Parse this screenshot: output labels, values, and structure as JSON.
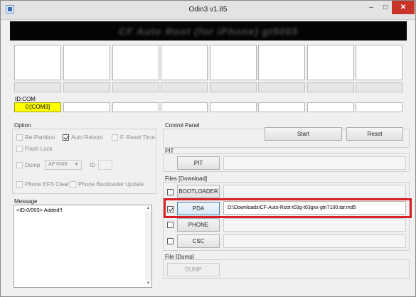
{
  "window": {
    "title": "Odin3 v1.85",
    "controls": {
      "minimize": "–",
      "maximize": "□",
      "close": "✕"
    }
  },
  "banner": {
    "text": "CF Auto Root (for iPhone) gt5005"
  },
  "id_com": {
    "label": "ID:COM",
    "ports": [
      "0:[COM3]",
      "",
      "",
      "",
      "",
      "",
      "",
      ""
    ]
  },
  "option": {
    "title": "Option",
    "re_partition": {
      "label": "Re-Partition",
      "checked": false,
      "enabled": false
    },
    "auto_reboot": {
      "label": "Auto Reboot",
      "checked": true,
      "enabled": false
    },
    "f_reset_time": {
      "label": "F. Reset Time",
      "checked": false,
      "enabled": false
    },
    "flash_lock": {
      "label": "Flash Lock",
      "checked": false,
      "enabled": false
    },
    "dump": {
      "label": "Dump",
      "checked": false,
      "enabled": false
    },
    "dump_target": "AP RAM",
    "id_label": "ID",
    "id_value": "",
    "phone_efs_clear": {
      "label": "Phone EFS Clear",
      "checked": false,
      "enabled": false
    },
    "phone_bootloader_update": {
      "label": "Phone Bootloader Update",
      "checked": false,
      "enabled": false
    }
  },
  "message": {
    "title": "Message",
    "log": "<ID:0/003> Added!!"
  },
  "control_panel": {
    "title": "Control Panel",
    "start_label": "Start",
    "reset_label": "Reset"
  },
  "pit": {
    "title": "PIT",
    "button_label": "PIT",
    "path": ""
  },
  "files": {
    "title": "Files [Download]",
    "bootloader": {
      "label": "BOOTLOADER",
      "checked": false,
      "path": ""
    },
    "pda": {
      "label": "PDA",
      "checked": true,
      "path": "D:\\Downloads\\CF-Auto-Root-t03g-t03gxx-gtn7100.tar.md5"
    },
    "phone": {
      "label": "PHONE",
      "checked": false,
      "path": ""
    },
    "csc": {
      "label": "CSC",
      "checked": false,
      "path": ""
    }
  },
  "file_dump": {
    "title": "File [Dump]",
    "button_label": "DUMP"
  },
  "colors": {
    "com_active": "#ffff00",
    "highlight": "#d92027",
    "close_button": "#c7352a",
    "banner": "#050505"
  }
}
